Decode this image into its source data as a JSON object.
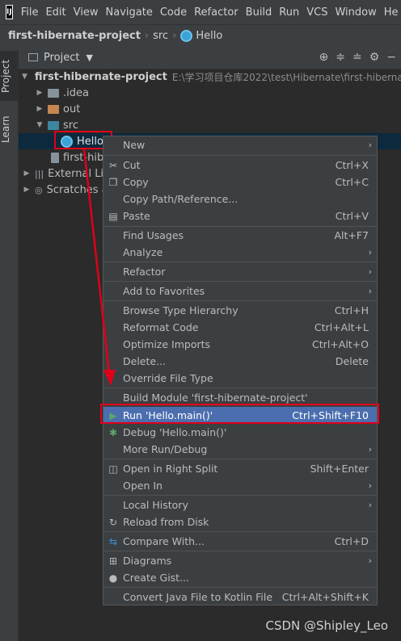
{
  "menubar": {
    "logo": "IJ",
    "items": [
      "File",
      "Edit",
      "View",
      "Navigate",
      "Code",
      "Refactor",
      "Build",
      "Run",
      "VCS",
      "Window",
      "He"
    ]
  },
  "breadcrumb": {
    "project": "first-hibernate-project",
    "folder": "src",
    "file": "Hello"
  },
  "stripe": {
    "project_tab": "Project",
    "learn_tab": "Learn"
  },
  "panel": {
    "title": "Project"
  },
  "tree": {
    "root_label": "first-hibernate-project",
    "root_path": "E:\\学习项目仓库2022\\test\\Hibernate\\first-hibernate",
    "idea": ".idea",
    "out": "out",
    "src": "src",
    "hello": "Hello",
    "iml": "first-hib",
    "external": "External Lib",
    "scratches": "Scratches a"
  },
  "context_menu": {
    "new": "New",
    "cut": "Cut",
    "cut_sc": "Ctrl+X",
    "copy": "Copy",
    "copy_sc": "Ctrl+C",
    "copy_path": "Copy Path/Reference...",
    "paste": "Paste",
    "paste_sc": "Ctrl+V",
    "find_usages": "Find Usages",
    "find_usages_sc": "Alt+F7",
    "analyze": "Analyze",
    "refactor": "Refactor",
    "add_fav": "Add to Favorites",
    "browse_type": "Browse Type Hierarchy",
    "browse_type_sc": "Ctrl+H",
    "reformat": "Reformat Code",
    "reformat_sc": "Ctrl+Alt+L",
    "optimize": "Optimize Imports",
    "optimize_sc": "Ctrl+Alt+O",
    "delete": "Delete...",
    "delete_sc": "Delete",
    "override": "Override File Type",
    "build_module": "Build Module 'first-hibernate-project'",
    "run": "Run 'Hello.main()'",
    "run_sc": "Ctrl+Shift+F10",
    "debug": "Debug 'Hello.main()'",
    "more_run": "More Run/Debug",
    "open_split": "Open in Right Split",
    "open_split_sc": "Shift+Enter",
    "open_in": "Open In",
    "local_history": "Local History",
    "reload": "Reload from Disk",
    "compare": "Compare With...",
    "compare_sc": "Ctrl+D",
    "diagrams": "Diagrams",
    "gist": "Create Gist...",
    "convert": "Convert Java File to Kotlin File",
    "convert_sc": "Ctrl+Alt+Shift+K"
  },
  "watermark": "CSDN @Shipley_Leo",
  "colors": {
    "highlight": "#4b6eaf",
    "annotation_red": "#e0001a",
    "run_green": "#59a869"
  }
}
